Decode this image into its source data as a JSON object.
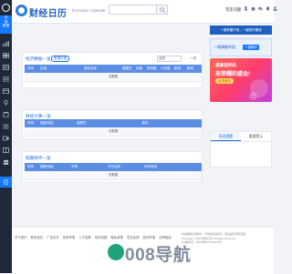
{
  "header": {
    "title": "财经日历",
    "subtitle": "Economic Calendar",
    "search_placeholder": "",
    "link_label": "常见问题"
  },
  "left_rail": {
    "feature_line1": "全",
    "feature_line2": "部",
    "feature_line3": "数据"
  },
  "main": {
    "sections": [
      {
        "title": "经济数据一览",
        "pill": "数据可视",
        "filter": "全部",
        "side": "一览",
        "columns": [
          "时间",
          "区域",
          "指标名称",
          "重要性",
          "前值",
          "预测值",
          "公布值",
          "影响",
          "解读"
        ],
        "empty_text": "无数据"
      },
      {
        "title": "财经大事一览",
        "columns": [
          "时间",
          "国家/地区",
          "重要性",
          "事件"
        ],
        "empty_text": "无数据"
      },
      {
        "title": "假期休市一览",
        "columns": [
          "时间",
          "国家/地区",
          "市场",
          "节日名称",
          "休市时间"
        ],
        "empty_text": "无数据"
      }
    ]
  },
  "aside": {
    "strip_text": "一键掌握市场，一键操作赚钱",
    "promo_text": "一键掌握牢固",
    "promo_btn": "一键操作",
    "ad_line1": "涌高低时机",
    "ad_line2": "来荣耀的盛会!",
    "ad_cta": "点击参与",
    "tabs": [
      "高亮提醒",
      "重要提示"
    ]
  },
  "footer": {
    "links": [
      "关于我们",
      "联系我们",
      "广告合作",
      "免责声明",
      "人才招聘",
      "网站地图",
      "隐私政策",
      "意见反馈",
      "投诉举报",
      "友情链接"
    ],
    "info": [
      "本站数据仅供参考，不构成投资建议，据此操作风险自担。",
      "Copyright © 2024 财经日历 All Rights Reserved.",
      "ICP备案号：沪ICP备XXXXXXXX号"
    ]
  },
  "watermark": {
    "text": "008导航"
  },
  "colors": {
    "brand": "#1f5fbf",
    "accent": "#1677ff",
    "rail_bg": "#20293a",
    "table_head": "#5b8de5"
  }
}
